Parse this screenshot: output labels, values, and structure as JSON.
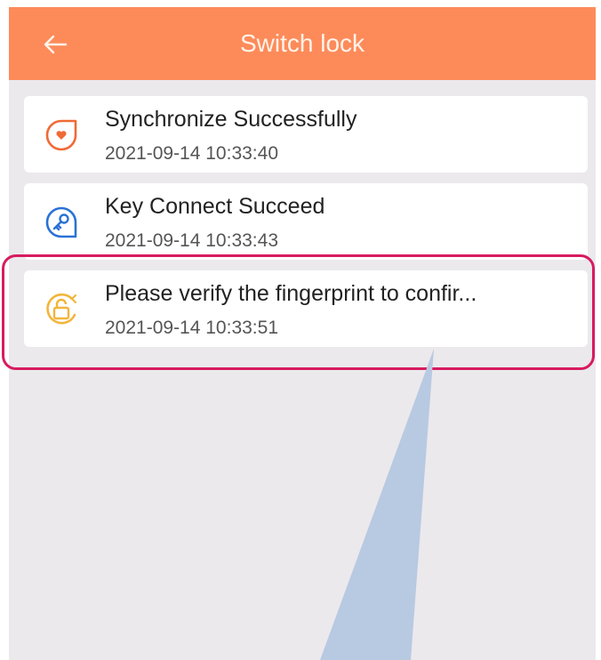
{
  "header": {
    "title": "Switch lock",
    "back_icon": "arrow-left-icon",
    "color": "#fd8b5a"
  },
  "messages": [
    {
      "text": "Synchronize Successfully",
      "time": "2021-09-14 10:33:40",
      "icon": "heart-chat-icon",
      "color": "#f06a35"
    },
    {
      "text": "Key Connect Succeed",
      "time": "2021-09-14 10:33:43",
      "icon": "key-icon",
      "color": "#2a72d6"
    },
    {
      "text": "Please verify the fingerprint to confir...",
      "time": "2021-09-14 10:33:51",
      "icon": "unlock-icon",
      "color": "#f2b53a"
    }
  ],
  "annotation": {
    "highlight_color": "#d81b60",
    "callout_color": "#b8c9e2"
  }
}
